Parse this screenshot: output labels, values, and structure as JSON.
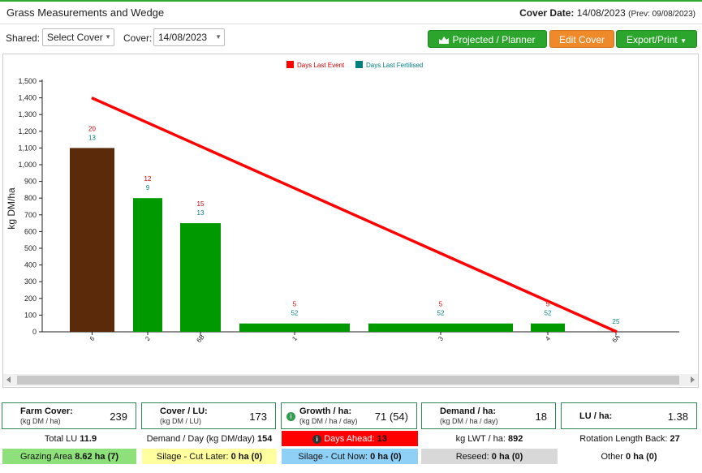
{
  "header": {
    "title": "Grass Measurements and Wedge",
    "cover_date_label": "Cover Date:",
    "cover_date_value": "14/08/2023",
    "prev_text": "(Prev: 09/08/2023)"
  },
  "toolbar": {
    "shared_label": "Shared:",
    "shared_select": "Select Cover",
    "cover_label": "Cover:",
    "cover_select": "14/08/2023",
    "projected_label": "Projected / Planner",
    "edit_label": "Edit Cover",
    "export_label": "Export/Print"
  },
  "colors": {
    "green": "#009900",
    "brown": "#5a2a0a",
    "line": "#ff0000",
    "fert": "#007f80",
    "days": "#cc0000"
  },
  "chart_data": {
    "type": "bar",
    "ylabel": "kg DM/ha",
    "ylim": [
      0,
      1500
    ],
    "yticks": [
      "0",
      "100",
      "200",
      "300",
      "400",
      "500",
      "600",
      "700",
      "800",
      "900",
      "1,000",
      "1,100",
      "1,200",
      "1,300",
      "1,400",
      "1,500"
    ],
    "legend": [
      "Days Last Event",
      "Days Last Fertilised"
    ],
    "categories": [
      "6",
      "2",
      "6B",
      "1",
      "3",
      "4",
      "6A"
    ],
    "values": [
      1100,
      800,
      650,
      50,
      50,
      50,
      0
    ],
    "bar_colors": [
      "#5a2a0a",
      "#009900",
      "#009900",
      "#009900",
      "#009900",
      "#009900",
      "#009900"
    ],
    "days_last_event": [
      "20",
      "12",
      "15",
      "5",
      "5",
      "5",
      ""
    ],
    "days_last_fertilised": [
      "13",
      "9",
      "13",
      "52",
      "52",
      "52",
      "25"
    ],
    "target_line": {
      "start": 1400,
      "end": 0
    }
  },
  "stats": {
    "farm_cover": {
      "title": "Farm Cover:",
      "unit": "(kg DM / ha)",
      "value": "239"
    },
    "cover_lu": {
      "title": "Cover / LU:",
      "unit": "(kg DM / LU)",
      "value": "173"
    },
    "growth": {
      "title": "Growth / ha:",
      "unit": "(kg DM / ha / day)",
      "value": "71 (54)"
    },
    "demand": {
      "title": "Demand / ha:",
      "unit": "(kg DM / ha / day)",
      "value": "18"
    },
    "lu_ha": {
      "title": "LU / ha:",
      "value": "1.38"
    },
    "total_lu_label": "Total LU",
    "total_lu_value": "11.9",
    "demand_day_label": "Demand / Day (kg DM/day)",
    "demand_day_value": "154",
    "days_ahead_label": "Days Ahead:",
    "days_ahead_value": "13",
    "lwt_label": "kg LWT / ha:",
    "lwt_value": "892",
    "rotation_label": "Rotation Length Back:",
    "rotation_value": "27",
    "grazing_label": "Grazing Area",
    "grazing_value": "8.62 ha (7)",
    "silage_later_label": "Silage - Cut Later:",
    "silage_later_value": "0 ha (0)",
    "silage_now_label": "Silage - Cut Now:",
    "silage_now_value": "0 ha (0)",
    "reseed_label": "Reseed:",
    "reseed_value": "0 ha (0)",
    "other_label": "Other",
    "other_value": "0 ha (0)"
  }
}
